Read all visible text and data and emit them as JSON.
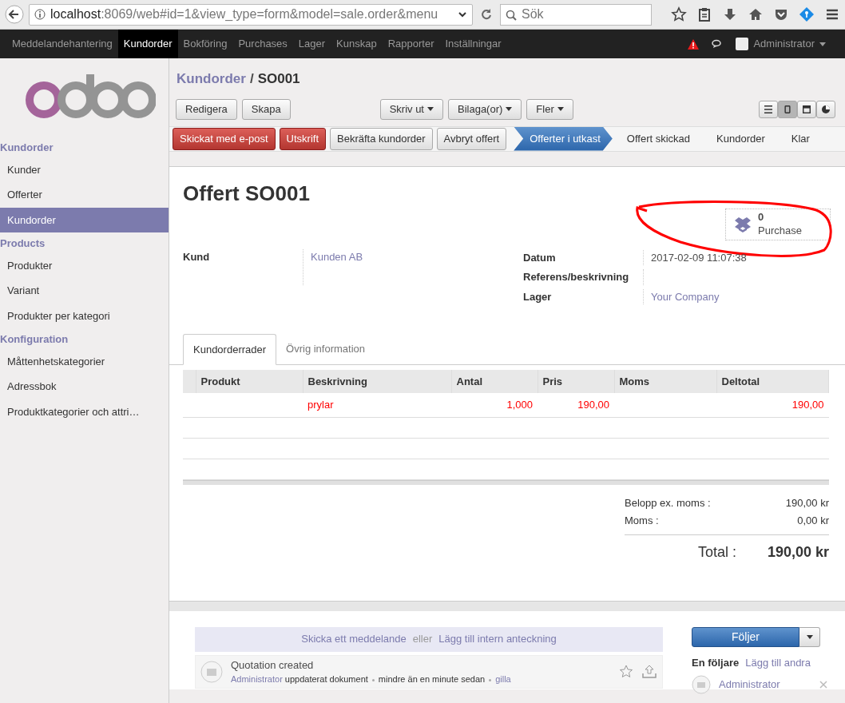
{
  "browser": {
    "url_host": "localhost",
    "url_rest": ":8069/web#id=1&view_type=form&model=sale.order&menu",
    "search_placeholder": "Sök"
  },
  "topnav": {
    "items": [
      {
        "label": "Meddelandehantering",
        "selected": false
      },
      {
        "label": "Kundorder",
        "selected": true
      },
      {
        "label": "Bokföring",
        "selected": false
      },
      {
        "label": "Purchases",
        "selected": false
      },
      {
        "label": "Lager",
        "selected": false
      },
      {
        "label": "Kunskap",
        "selected": false
      },
      {
        "label": "Rapporter",
        "selected": false
      },
      {
        "label": "Inställningar",
        "selected": false
      }
    ],
    "user": "Administrator"
  },
  "sidebar": {
    "sections": [
      {
        "title": "Kundorder",
        "items": [
          {
            "label": "Kunder",
            "selected": false
          },
          {
            "label": "Offerter",
            "selected": false
          },
          {
            "label": "Kundorder",
            "selected": true
          }
        ]
      },
      {
        "title": "Products",
        "items": [
          {
            "label": "Produkter",
            "selected": false
          },
          {
            "label": "Variant",
            "selected": false
          },
          {
            "label": "Produkter per kategori",
            "selected": false
          }
        ]
      },
      {
        "title": "Konfiguration",
        "items": [
          {
            "label": "Måttenhetskategorier",
            "selected": false
          },
          {
            "label": "Adressbok",
            "selected": false
          },
          {
            "label": "Produktkategorier och attri…",
            "selected": false
          }
        ]
      }
    ]
  },
  "breadcrumb": {
    "parent": "Kundorder",
    "separator": "/",
    "current": "SO001"
  },
  "action_buttons": [
    "Redigera",
    "Skapa"
  ],
  "dropdown_buttons": [
    "Skriv ut",
    "Bilaga(or)",
    "Fler"
  ],
  "view_switcher": [
    {
      "kind": "list",
      "selected": false
    },
    {
      "kind": "form",
      "selected": true
    },
    {
      "kind": "calendar",
      "selected": false
    },
    {
      "kind": "graph",
      "selected": false
    }
  ],
  "status_buttons": [
    {
      "label": "Skickat med e-post",
      "kind": "danger"
    },
    {
      "label": "Utskrift",
      "kind": "danger"
    },
    {
      "label": "Bekräfta kundorder",
      "kind": "default"
    },
    {
      "label": "Avbryt offert",
      "kind": "default"
    }
  ],
  "stages": [
    {
      "label": "Offerter i utkast",
      "selected": true
    },
    {
      "label": "Offert skickad",
      "selected": false
    },
    {
      "label": "Kundorder",
      "selected": false
    },
    {
      "label": "Klar",
      "selected": false
    }
  ],
  "form": {
    "title": "Offert SO001",
    "smart_button": {
      "count": "0",
      "label": "Purchase"
    },
    "left_fields": [
      {
        "label": "Kund",
        "value": "Kunden AB",
        "kind": "link"
      }
    ],
    "right_fields": [
      {
        "label": "Datum",
        "value": "2017-02-09 11:07:38",
        "kind": "text"
      },
      {
        "label": "Referens/beskrivning"
      },
      {
        "label": "Lager",
        "value": "Your Company",
        "kind": "link"
      }
    ],
    "tabs": [
      {
        "label": "Kundorderrader",
        "selected": true
      },
      {
        "label": "Övrig information",
        "selected": false
      }
    ],
    "table": {
      "columns": [
        "Produkt",
        "Beskrivning",
        "Antal",
        "Pris",
        "Moms",
        "Deltotal"
      ],
      "rows": [
        {
          "description": "prylar",
          "quantity": "1,000",
          "price": "190,00",
          "subtotal": "190,00"
        }
      ]
    },
    "totals": [
      {
        "label": "Belopp ex. moms :",
        "value": "190,00 kr",
        "kind": "sub"
      },
      {
        "label": "Moms :",
        "value": "0,00 kr",
        "kind": "sub"
      },
      {
        "label": "Total :",
        "value": "190,00 kr",
        "kind": "grand"
      }
    ]
  },
  "chatter": {
    "send": "Skicka ett meddelande",
    "or": "eller",
    "note": "Lägg till intern anteckning",
    "messages": [
      {
        "subject": "Quotation created",
        "author": "Administrator",
        "action": "uppdaterat dokument",
        "time": "mindre än en minute sedan",
        "like": "gilla"
      }
    ],
    "follow_button": "Följer",
    "followers_title": "En följare",
    "add_followers": "Lägg till andra",
    "followers": [
      {
        "name": "Administrator"
      }
    ]
  }
}
